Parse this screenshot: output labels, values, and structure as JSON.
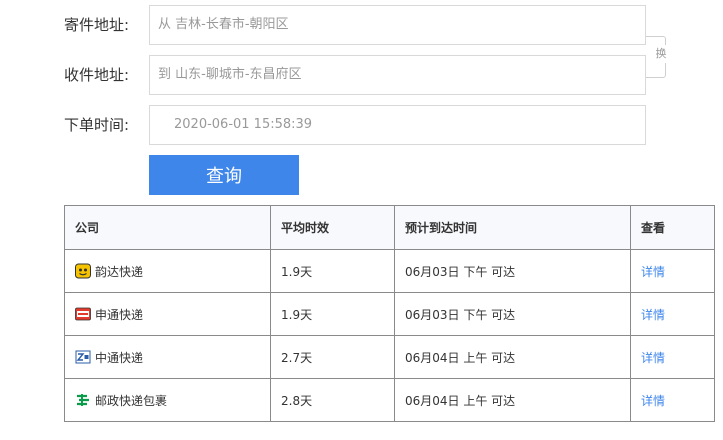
{
  "form": {
    "sender_label": "寄件地址:",
    "sender_value": "从 吉林-长春市-朝阳区",
    "receiver_label": "收件地址:",
    "receiver_value": "到 山东-聊城市-东昌府区",
    "time_label": "下单时间:",
    "time_value": "2020-06-01 15:58:39",
    "swap_label": "换",
    "query_button": "查询"
  },
  "table": {
    "headers": [
      "公司",
      "平均时效",
      "预计到达时间",
      "查看"
    ],
    "rows": [
      {
        "company": "韵达快递",
        "logo": "yunda-logo-icon",
        "avg_time": "1.9天",
        "eta": "06月03日 下午 可达",
        "action": "详情"
      },
      {
        "company": "申通快递",
        "logo": "sto-logo-icon",
        "avg_time": "1.9天",
        "eta": "06月03日 下午 可达",
        "action": "详情"
      },
      {
        "company": "中通快递",
        "logo": "zto-logo-icon",
        "avg_time": "2.7天",
        "eta": "06月04日 上午 可达",
        "action": "详情"
      },
      {
        "company": "邮政快递包裹",
        "logo": "ems-logo-icon",
        "avg_time": "2.8天",
        "eta": "06月04日 上午 可达",
        "action": "详情"
      }
    ]
  },
  "colors": {
    "accent": "#3f86ea",
    "border": "#8a8a8a",
    "header_bg": "#f7f9fc"
  }
}
